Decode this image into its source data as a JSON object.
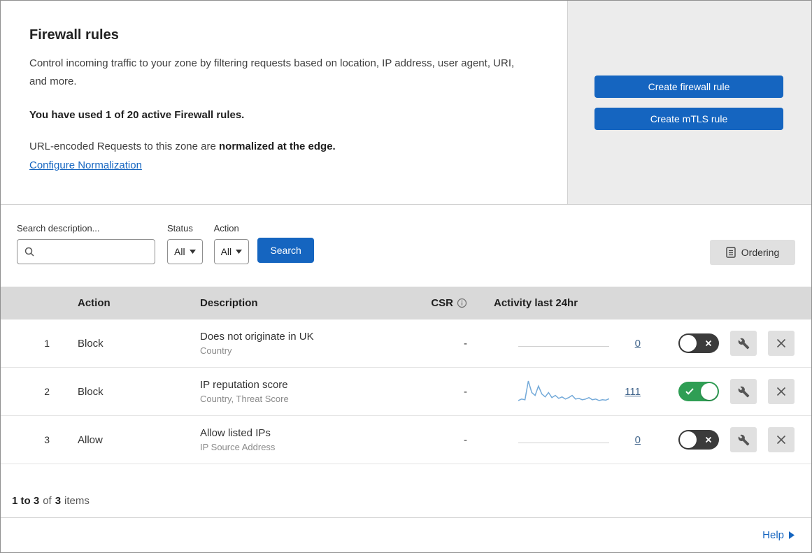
{
  "colors": {
    "accent": "#1565c0",
    "toggle_on": "#2f9e54",
    "sparkline": "#74aad9"
  },
  "header": {
    "title": "Firewall rules",
    "description": "Control incoming traffic to your zone by filtering requests based on location, IP address, user agent, URI, and more.",
    "usage_bold": "You have used 1 of 20 active Firewall rules.",
    "normalization_prefix": "URL-encoded Requests to this zone are ",
    "normalization_bold": "normalized at the edge.",
    "normalization_link": "Configure Normalization",
    "buttons": {
      "create_firewall": "Create firewall rule",
      "create_mtls": "Create mTLS rule"
    }
  },
  "filters": {
    "search_label": "Search description...",
    "status_label": "Status",
    "status_value": "All",
    "action_label": "Action",
    "action_value": "All",
    "search_button": "Search",
    "ordering_button": "Ordering"
  },
  "table": {
    "headers": {
      "action": "Action",
      "description": "Description",
      "csr": "CSR",
      "activity": "Activity last 24hr"
    },
    "rows": [
      {
        "num": "1",
        "action": "Block",
        "description": "Does not originate in UK",
        "sub": "Country",
        "csr": "-",
        "activity_count": "0",
        "enabled": false,
        "trend": null
      },
      {
        "num": "2",
        "action": "Block",
        "description": "IP reputation score",
        "sub": "Country, Threat Score",
        "csr": "-",
        "activity_count": "111",
        "enabled": true,
        "trend": [
          8,
          12,
          10,
          62,
          30,
          22,
          48,
          26,
          18,
          30,
          16,
          22,
          14,
          18,
          12,
          16,
          22,
          12,
          14,
          10,
          12,
          16,
          10,
          12,
          8,
          10,
          9,
          13
        ]
      },
      {
        "num": "3",
        "action": "Allow",
        "description": "Allow listed IPs",
        "sub": "IP Source Address",
        "csr": "-",
        "activity_count": "0",
        "enabled": false,
        "trend": null
      }
    ],
    "footer": {
      "range": "1 to 3",
      "of": "of",
      "total": "3",
      "items": "items"
    }
  },
  "help": {
    "label": "Help"
  }
}
